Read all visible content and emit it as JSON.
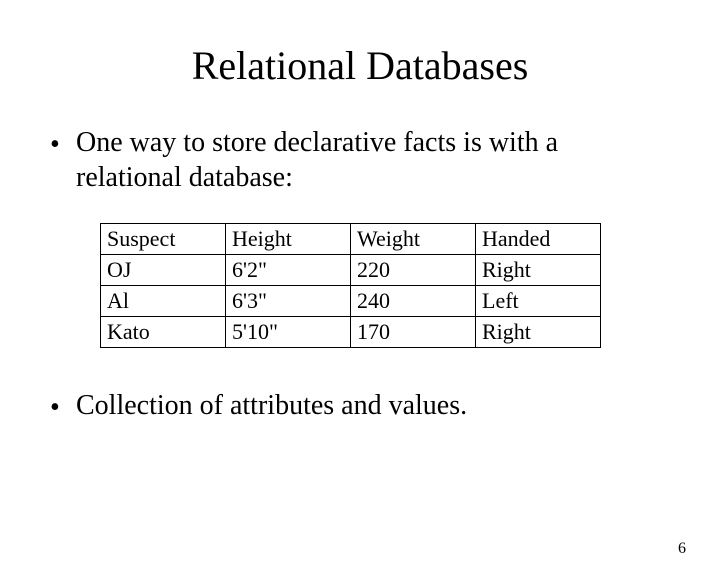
{
  "title": "Relational Databases",
  "bullets": {
    "b1": "One way to store declarative facts is with a relational database:",
    "b2": "Collection of attributes and values."
  },
  "table": {
    "headers": {
      "c0": "Suspect",
      "c1": "Height",
      "c2": "Weight",
      "c3": "Handed"
    },
    "rows": [
      {
        "c0": "OJ",
        "c1": "6'2\"",
        "c2": "220",
        "c3": "Right"
      },
      {
        "c0": "Al",
        "c1": "6'3\"",
        "c2": "240",
        "c3": "Left"
      },
      {
        "c0": "Kato",
        "c1": "5'10\"",
        "c2": "170",
        "c3": "Right"
      }
    ]
  },
  "page_number": "6",
  "chart_data": {
    "type": "table",
    "title": "Relational Databases",
    "columns": [
      "Suspect",
      "Height",
      "Weight",
      "Handed"
    ],
    "rows": [
      [
        "OJ",
        "6'2\"",
        220,
        "Right"
      ],
      [
        "Al",
        "6'3\"",
        240,
        "Left"
      ],
      [
        "Kato",
        "5'10\"",
        170,
        "Right"
      ]
    ]
  }
}
